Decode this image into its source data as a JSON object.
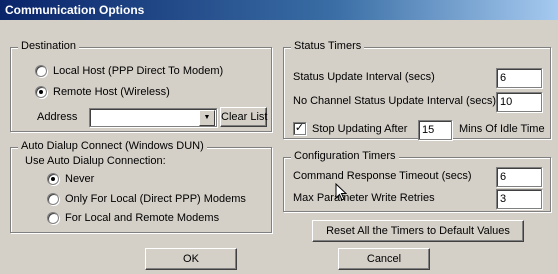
{
  "window": {
    "title": "Communication Options"
  },
  "destination": {
    "legend": "Destination",
    "local_host_label": "Local Host (PPP Direct To Modem)",
    "remote_host_label": "Remote Host (Wireless)",
    "selected": "remote_host",
    "address_label": "Address",
    "address_value": "",
    "clear_list_label": "Clear List"
  },
  "auto_dialup": {
    "legend": "Auto Dialup Connect (Windows DUN)",
    "use_label": "Use Auto Dialup Connection:",
    "options": [
      {
        "label": "Never",
        "selected": true
      },
      {
        "label": "Only For Local (Direct PPP) Modems",
        "selected": false
      },
      {
        "label": "For Local and Remote Modems",
        "selected": false
      }
    ]
  },
  "status_timers": {
    "legend": "Status Timers",
    "status_update_label": "Status Update Interval (secs)",
    "status_update_value": "6",
    "no_channel_label": "No Channel Status Update Interval (secs)",
    "no_channel_value": "10",
    "stop_updating_label": "Stop Updating After",
    "stop_updating_checked": true,
    "stop_updating_value": "15",
    "idle_label": "Mins Of Idle Time"
  },
  "config_timers": {
    "legend": "Configuration Timers",
    "command_timeout_label": "Command Response Timeout (secs)",
    "command_timeout_value": "6",
    "max_retries_label": "Max Parameter Write Retries",
    "max_retries_value": "3"
  },
  "buttons": {
    "reset_label": "Reset All the Timers to Default Values",
    "ok_label": "OK",
    "cancel_label": "Cancel"
  }
}
